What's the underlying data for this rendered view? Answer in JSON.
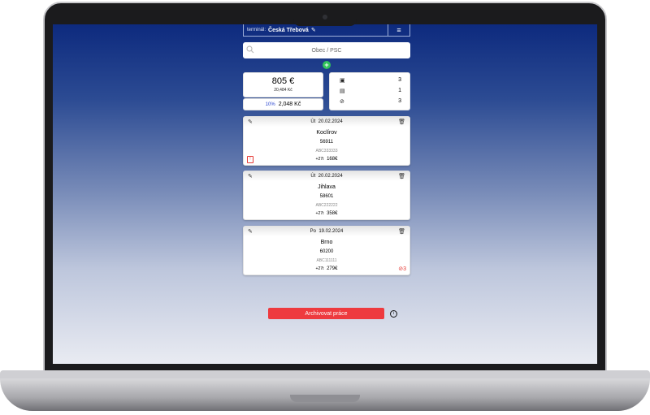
{
  "header": {
    "terminal_label": "terminál:",
    "terminal_value": "Česká Třebová",
    "edit_glyph": "✎",
    "menu_glyph": "≡"
  },
  "search": {
    "placeholder": "Obec / PSC"
  },
  "add_glyph": "+",
  "summary": {
    "total_eur": "805 €",
    "total_czk": "20,484 Kč",
    "percent": "10%",
    "percent_value": "2,048 Kč"
  },
  "stats": [
    {
      "icon": "briefcase-icon",
      "glyph": "▣",
      "value": "3"
    },
    {
      "icon": "document-icon",
      "glyph": "▤",
      "value": "1"
    },
    {
      "icon": "cancel-icon",
      "glyph": "⊘",
      "value": "3"
    }
  ],
  "jobs": [
    {
      "day": "Út",
      "date": "20.02.2024",
      "city": "Koclírov",
      "psc": "56911",
      "code": "ABC333333",
      "weight": "+27t",
      "price": "168€",
      "left_flag": "!",
      "right_flag": ""
    },
    {
      "day": "Út",
      "date": "20.02.2024",
      "city": "Jihlava",
      "psc": "58601",
      "code": "ABC222222",
      "weight": "+27t",
      "price": "358€",
      "left_flag": "",
      "right_flag": ""
    },
    {
      "day": "Po",
      "date": "19.02.2024",
      "city": "Brno",
      "psc": "60200",
      "code": "ABC111111",
      "weight": "+27t",
      "price": "279€",
      "left_flag": "",
      "right_flag": "⊘3"
    }
  ],
  "actions": {
    "archive_label": "Archivovat práce",
    "info_glyph": "i"
  },
  "colors": {
    "accent_red": "#ee3a3f",
    "add_green": "#30c35a",
    "percent_blue": "#2b47d0"
  }
}
